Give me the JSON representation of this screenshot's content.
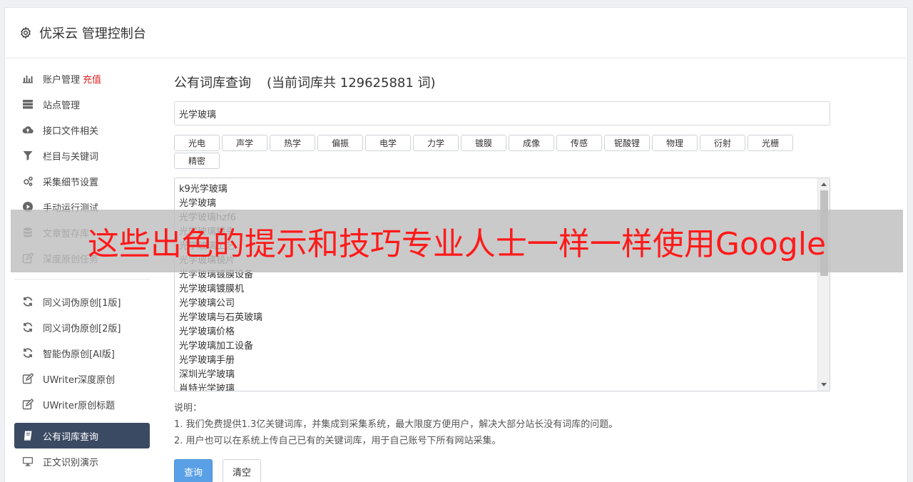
{
  "header": {
    "title": "优采云 管理控制台",
    "icon": "gear-icon"
  },
  "sidebar": {
    "group1": [
      {
        "label": "账户管理",
        "badge": "充值",
        "icon": "bar-chart-icon"
      },
      {
        "label": "站点管理",
        "icon": "server-icon"
      },
      {
        "label": "接口文件相关",
        "icon": "cloud-upload-icon"
      },
      {
        "label": "栏目与关键词",
        "icon": "filter-icon"
      },
      {
        "label": "采集细节设置",
        "icon": "gears-icon"
      },
      {
        "label": "手动运行测试",
        "icon": "play-icon"
      },
      {
        "label": "文章暂存库",
        "icon": "database-icon"
      },
      {
        "label": "深度原创任务",
        "icon": "edit-icon"
      }
    ],
    "group2": [
      {
        "label": "同义词伪原创[1版]",
        "icon": "refresh-icon"
      },
      {
        "label": "同义词伪原创[2版]",
        "icon": "refresh-icon"
      },
      {
        "label": "智能伪原创[AI版]",
        "icon": "refresh-icon"
      },
      {
        "label": "UWriter深度原创",
        "icon": "edit-icon"
      },
      {
        "label": "UWriter原创标题",
        "icon": "edit-icon"
      }
    ],
    "group3": [
      {
        "label": "公有词库查询",
        "icon": "book-icon",
        "active": true
      },
      {
        "label": "正文识别演示",
        "icon": "monitor-icon"
      }
    ]
  },
  "main": {
    "title": "公有词库查询",
    "count_text": "(当前词库共 129625881 词)",
    "search_value": "光学玻璃",
    "tags": [
      "光电",
      "声学",
      "热学",
      "偏振",
      "电学",
      "力学",
      "镀膜",
      "成像",
      "传感",
      "铌酸锂",
      "物理",
      "衍射",
      "光栅",
      "精密"
    ],
    "results": [
      "k9光学玻璃",
      "光学玻璃",
      "光学玻璃hzf6",
      "光学玻璃镜头",
      "光学玻璃工艺",
      "光学玻璃镜片",
      "光学玻璃镀膜设备",
      "光学玻璃镀膜机",
      "光学玻璃公司",
      "光学玻璃与石英玻璃",
      "光学玻璃价格",
      "光学玻璃加工设备",
      "光学玻璃手册",
      "深圳光学玻璃",
      "肖特光学玻璃"
    ],
    "notes_title": "说明：",
    "notes": [
      "1. 我们免费提供1.3亿关键词库，并集成到采集系统，最大限度方便用户，解决大部分站长没有词库的问题。",
      "2. 用户也可以在系统上传自己已有的关键词库，用于自己账号下所有网站采集。"
    ],
    "query_button": "查询",
    "clear_button": "清空"
  },
  "overlay_text": "这些出色的提示和技巧专业人士一样一样使用Google",
  "colors": {
    "active_nav": "#3b4a63",
    "primary_button": "#5aa0e6",
    "badge": "#e02020",
    "overlay_text": "#ff1a1a"
  }
}
